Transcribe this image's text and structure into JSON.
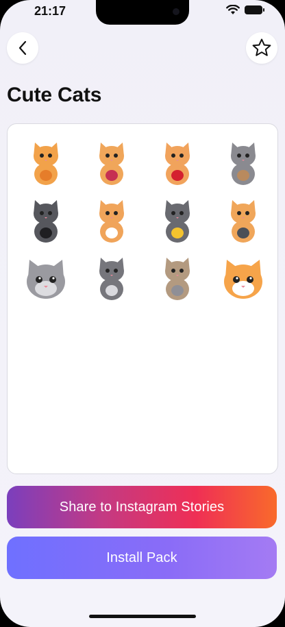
{
  "status_bar": {
    "time": "21:17"
  },
  "nav": {
    "back_icon": "chevron-left-icon",
    "favorite_icon": "star-outline-icon"
  },
  "pack": {
    "title": "Cute Cats",
    "stickers": [
      {
        "name": "sleeping-cat-sticker",
        "colors": [
          "#f2a24a",
          "#e67d2a"
        ]
      },
      {
        "name": "cat-with-yarn-sticker",
        "colors": [
          "#f0a65a",
          "#c63052"
        ]
      },
      {
        "name": "cat-with-heart-sticker",
        "colors": [
          "#f1a35c",
          "#d4202f"
        ]
      },
      {
        "name": "cat-in-box-sticker",
        "colors": [
          "#8a8a90",
          "#b98a5e"
        ]
      },
      {
        "name": "cat-with-glasses-sticker",
        "colors": [
          "#56575d",
          "#1f1f22"
        ]
      },
      {
        "name": "chef-cat-sticker",
        "colors": [
          "#f0a45a",
          "#ffffff"
        ]
      },
      {
        "name": "party-hat-cat-sticker",
        "colors": [
          "#696a70",
          "#f3c32e"
        ]
      },
      {
        "name": "cat-on-laptop-sticker",
        "colors": [
          "#f0a65a",
          "#4b4f57"
        ]
      },
      {
        "name": "tabby-kitten-face-sticker",
        "colors": [
          "#9a9aa0",
          "#dcdce0"
        ]
      },
      {
        "name": "stretching-cat-sticker",
        "colors": [
          "#76767c",
          "#d9d9de"
        ]
      },
      {
        "name": "cat-holding-fish-sticker",
        "colors": [
          "#b39a80",
          "#8f8f96"
        ]
      },
      {
        "name": "winking-cat-face-sticker",
        "colors": [
          "#f6a44a",
          "#ffffff"
        ]
      }
    ]
  },
  "actions": {
    "share_label": "Share to Instagram Stories",
    "install_label": "Install Pack"
  }
}
